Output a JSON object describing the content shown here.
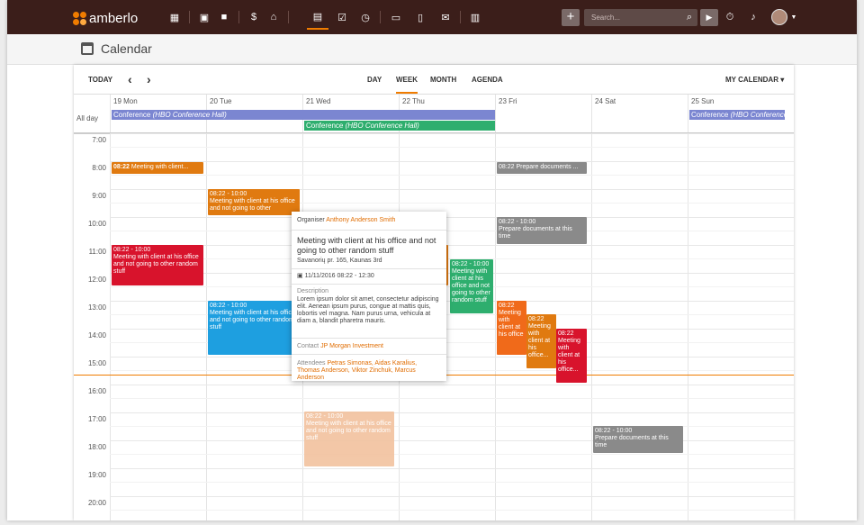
{
  "app": {
    "logo": "amberlo",
    "title": "Calendar"
  },
  "topbar": {
    "search_placeholder": "Search..."
  },
  "toolbar": {
    "today": "TODAY",
    "prev": "‹",
    "next": "›",
    "views": [
      "DAY",
      "WEEK",
      "MONTH",
      "AGENDA"
    ],
    "active_view": "WEEK",
    "calendar_select": "MY CALENDAR"
  },
  "days": [
    "19 Mon",
    "20 Tue",
    "21 Wed",
    "22 Thu",
    "23 Fri",
    "24 Sat",
    "25 Sun"
  ],
  "allday_label": "All day",
  "times": [
    "7:00",
    "8:00",
    "9:00",
    "10:00",
    "11:00",
    "12:00",
    "13:00",
    "14:00",
    "15:00",
    "16:00",
    "17:00",
    "18:00",
    "19:00",
    "20:00"
  ],
  "allday_events": [
    {
      "title": "Conference",
      "location": "(HBO Conference Hall)",
      "color": "#7b86d1"
    },
    {
      "title": "Conference",
      "location": "(HBO Conference Hall)",
      "color": "#2eae6e"
    },
    {
      "title": "Conference",
      "location": "(HBO Conference...",
      "color": "#7b86d1"
    }
  ],
  "events": [
    {
      "time": "08:22",
      "title": "Meeting with client...",
      "color": "#e07a10"
    },
    {
      "time": "08:22 - 10:00",
      "title": "Meeting with client at his office and not going to other",
      "color": "#e07a10"
    },
    {
      "time": "08:22 - 10:00",
      "title": "Meeting with client at his office and not going to other random stuff",
      "color": "#d8132c"
    },
    {
      "time": "08:22 - 10:00",
      "title": "Meeting with client at his office and not going to other random stuff",
      "color": "#1e9fe0"
    },
    {
      "time": "08:22 - 10:00",
      "title": "Meeting with client at his office and not going to other random stuff",
      "color": "#f2c29e"
    },
    {
      "time": "08:22 - 10:00",
      "title": "Meeting with client at his office and not going to other random stuff",
      "color": "#2eae6e"
    },
    {
      "time": "08:22",
      "title": "Prepare documents ...",
      "color": "#8a8a8a"
    },
    {
      "time": "08:22 - 10:00",
      "title": "Prepare documents at this time",
      "color": "#8a8a8a"
    },
    {
      "time": "08:22",
      "title": "Meeting with client at his office",
      "color": "#f06a1a"
    },
    {
      "time": "08:22",
      "title": "Meeting with client at his office...",
      "color": "#e07a10"
    },
    {
      "time": "08:22",
      "title": "Meeting with client at his office...",
      "color": "#d8132c"
    },
    {
      "time": "08:22 - 10:00",
      "title": "Prepare documents at this time",
      "color": "#8a8a8a"
    }
  ],
  "popup": {
    "organiser_label": "Organiser",
    "organiser": "Anthony Anderson Smith",
    "title": "Meeting with client at his office and not going to other random stuff",
    "address": "Savanorių pr. 165, Kaunas 3rd",
    "datetime": "11/11/2016 08:22 - 12:30",
    "description_label": "Description",
    "description": "Lorem ipsum dolor sit amet, consectetur adipiscing elit. Aenean ipsum purus, congue at mattis quis, lobortis vel magna. Nam purus urna, vehicula at diam a, blandit pharetra mauris.",
    "contact_label": "Contact",
    "contact": "JP Morgan Investment",
    "attendees_label": "Attendees",
    "attendees": "Petras Simonas, Aidas Karalius, Thomas Anderson, Viktor Zinchuk, Marcus Anderson"
  },
  "colors": {
    "brand": "#f07c00",
    "topbar": "#3b1e1a"
  }
}
